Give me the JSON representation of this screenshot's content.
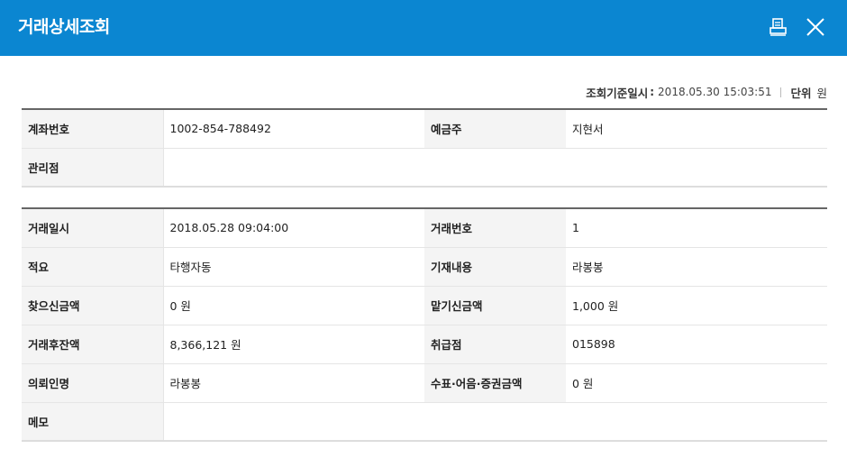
{
  "header": {
    "title": "거래상세조회",
    "background_color": "#0b86d1",
    "icons": [
      "print-icon",
      "close-icon"
    ]
  },
  "meta": {
    "query_label": "조회기준일시",
    "query_colon": ":",
    "query_value": "2018.05.30 15:03:51",
    "unit_label": "단위",
    "unit_value": "원"
  },
  "account": {
    "rows": [
      {
        "label1": "계좌번호",
        "value1": "1002-854-788492",
        "label2": "예금주",
        "value2": "지현서"
      },
      {
        "label1": "관리점",
        "value1": ""
      }
    ]
  },
  "transaction": {
    "rows": [
      {
        "label1": "거래일시",
        "value1": "2018.05.28 09:04:00",
        "label2": "거래번호",
        "value2": "1"
      },
      {
        "label1": "적요",
        "value1": "타행자동",
        "label2": "기재내용",
        "value2": "라봉봉"
      },
      {
        "label1": "찾으신금액",
        "value1": "0 원",
        "label2": "맡기신금액",
        "value2": "1,000 원"
      },
      {
        "label1": "거래후잔액",
        "value1": "8,366,121 원",
        "label2": "취급점",
        "value2": "015898"
      },
      {
        "label1": "의뢰인명",
        "value1": "라봉봉",
        "label2": "수표·어음·증권금액",
        "value2": "0 원"
      },
      {
        "label1": "메모",
        "value1": ""
      }
    ]
  }
}
